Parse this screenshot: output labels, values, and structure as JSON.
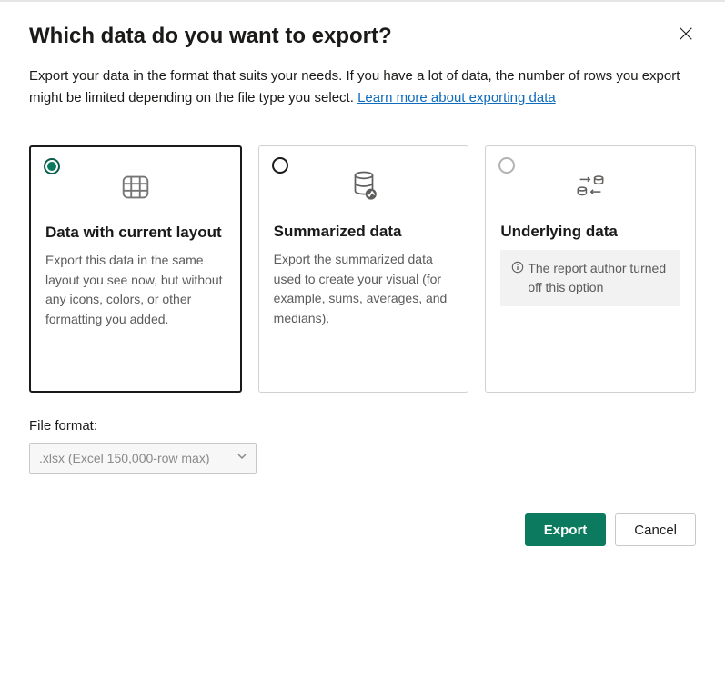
{
  "dialog": {
    "title": "Which data do you want to export?",
    "description_prefix": "Export your data in the format that suits your needs. If you have a lot of data, the number of rows you export might be limited depending on the file type you select.  ",
    "learn_more_label": "Learn more about exporting data"
  },
  "options": [
    {
      "id": "current_layout",
      "title": "Data with current layout",
      "description": "Export this data in the same layout you see now, but without any icons, colors, or other formatting you added.",
      "selected": true,
      "disabled": false
    },
    {
      "id": "summarized",
      "title": "Summarized data",
      "description": "Export the summarized data used to create your visual (for example, sums, averages, and medians).",
      "selected": false,
      "disabled": false
    },
    {
      "id": "underlying",
      "title": "Underlying data",
      "description": "",
      "selected": false,
      "disabled": true,
      "disabled_message": "The report author turned off this option"
    }
  ],
  "file_format": {
    "label": "File format:",
    "selected": ".xlsx (Excel 150,000-row max)",
    "disabled": true
  },
  "buttons": {
    "export": "Export",
    "cancel": "Cancel"
  }
}
